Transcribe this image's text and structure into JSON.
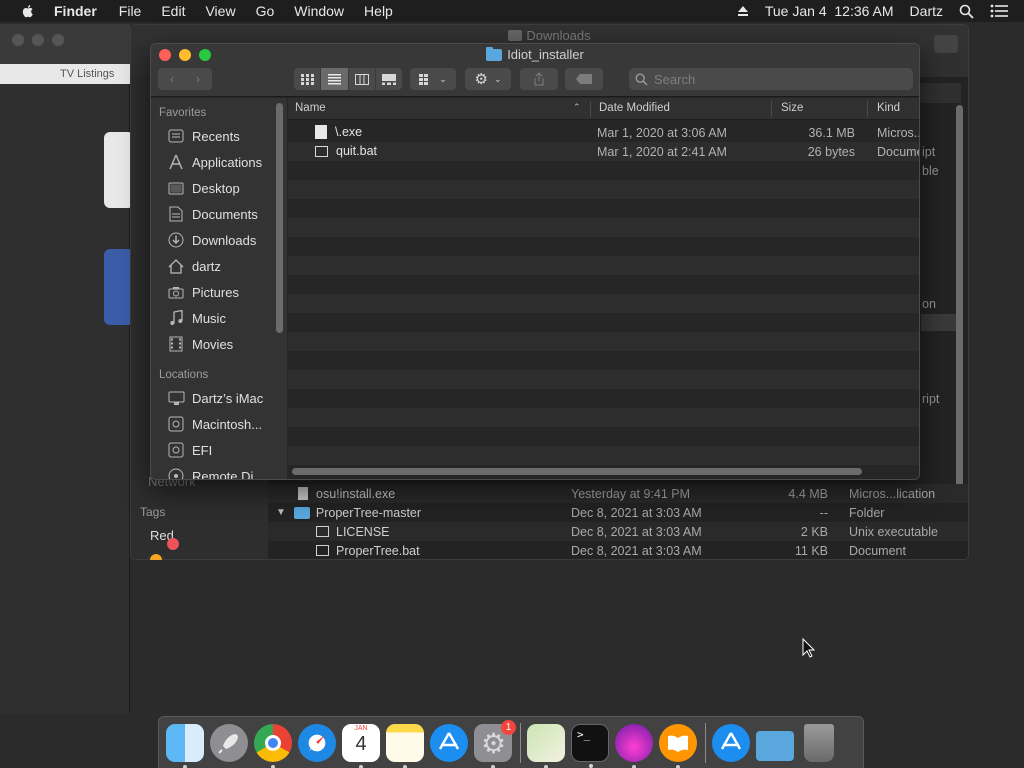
{
  "menubar": {
    "app": "Finder",
    "menus": [
      "File",
      "Edit",
      "View",
      "Go",
      "Window",
      "Help"
    ],
    "clock": "Tue Jan 4  12:36 AM",
    "user": "Dartz"
  },
  "background_window": {
    "title": "Downloads",
    "partial_tab": "TV Listings",
    "rows": [
      {
        "name": "osu!install.exe",
        "date": "Yesterday at 9:41 PM",
        "size": "4.4 MB",
        "kind": "Micros...lication"
      },
      {
        "name": "ProperTree-master",
        "date": "Dec 8, 2021 at 3:03 AM",
        "size": "--",
        "kind": "Folder"
      },
      {
        "name": "LICENSE",
        "date": "Dec 8, 2021 at 3:03 AM",
        "size": "2 KB",
        "kind": "Unix executable"
      },
      {
        "name": "ProperTree.bat",
        "date": "Dec 8, 2021 at 3:03 AM",
        "size": "11 KB",
        "kind": "Document"
      }
    ],
    "side_fragments": [
      "ipt",
      "ble",
      "on",
      "ript"
    ],
    "tags_label": "Tags",
    "tag_red": "Red",
    "network": "Network"
  },
  "window": {
    "title": "Idiot_installer",
    "search_placeholder": "Search",
    "sidebar": {
      "favorites_label": "Favorites",
      "favorites": [
        {
          "label": "Recents",
          "icon": "recents-icon"
        },
        {
          "label": "Applications",
          "icon": "applications-icon"
        },
        {
          "label": "Desktop",
          "icon": "desktop-icon"
        },
        {
          "label": "Documents",
          "icon": "documents-icon"
        },
        {
          "label": "Downloads",
          "icon": "downloads-icon"
        },
        {
          "label": "dartz",
          "icon": "home-icon"
        },
        {
          "label": "Pictures",
          "icon": "camera-icon"
        },
        {
          "label": "Music",
          "icon": "music-icon"
        },
        {
          "label": "Movies",
          "icon": "movies-icon"
        }
      ],
      "locations_label": "Locations",
      "locations": [
        {
          "label": "Dartz’s iMac",
          "icon": "imac-icon"
        },
        {
          "label": "Macintosh...",
          "icon": "disk-icon"
        },
        {
          "label": "EFI",
          "icon": "disk-icon"
        },
        {
          "label": "Remote Di...",
          "icon": "remote-disc-icon"
        }
      ]
    },
    "columns": {
      "name": "Name",
      "date": "Date Modified",
      "size": "Size",
      "kind": "Kind"
    },
    "files": [
      {
        "name": "\\.exe",
        "date": "Mar 1, 2020 at 3:06 AM",
        "size": "36.1 MB",
        "kind": "Micros..."
      },
      {
        "name": "quit.bat",
        "date": "Mar 1, 2020 at 2:41 AM",
        "size": "26 bytes",
        "kind": "Document"
      }
    ]
  },
  "dock": {
    "calendar_month": "JAN",
    "calendar_day": "4",
    "badge_count": "1",
    "terminal_prompt": ">_"
  },
  "colors": {
    "accent_blue": "#5aa7dd",
    "close": "#ff5f57",
    "minimize": "#febc2e",
    "zoom": "#28c840",
    "tag_red": "#f0515a"
  }
}
